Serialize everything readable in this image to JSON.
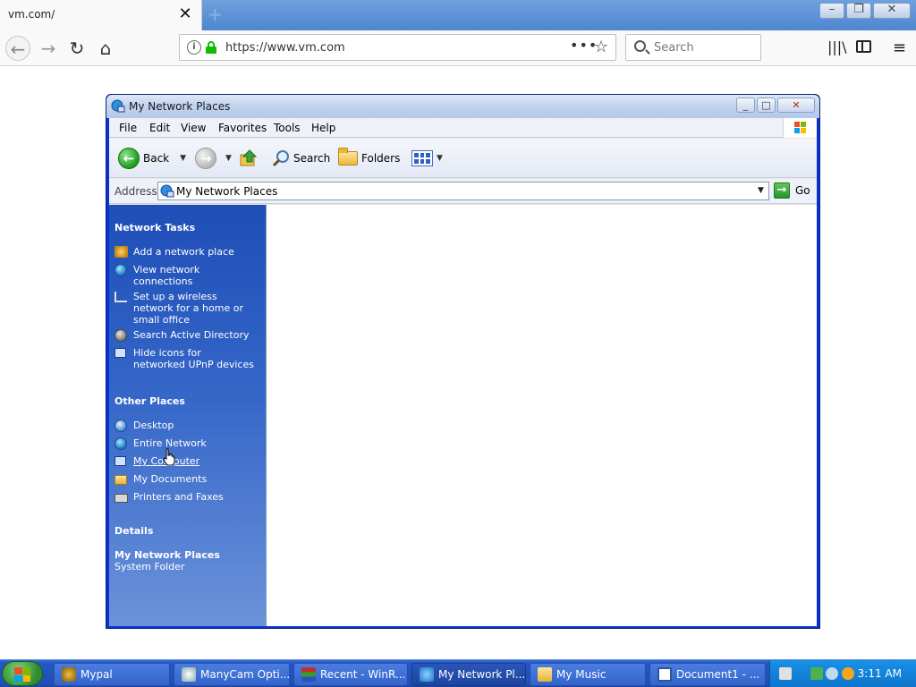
{
  "browser": {
    "tab_title": "vm.com/",
    "tab_close": "✕",
    "new_tab": "+",
    "url": "https://www.vm.com",
    "search_placeholder": "Search",
    "url_menu": "•••",
    "bookmark_star": "☆",
    "library": "|||\\",
    "menu": "≡"
  },
  "window": {
    "title": "My Network Places",
    "menus": [
      "File",
      "Edit",
      "View",
      "Favorites",
      "Tools",
      "Help"
    ],
    "toolbar": {
      "back": "Back",
      "search": "Search",
      "folders": "Folders"
    },
    "address_label": "Address",
    "address_value": "My Network Places",
    "go_label": "Go"
  },
  "sidebar": {
    "network_tasks_title": "Network Tasks",
    "network_tasks": [
      {
        "label": "Add a network place",
        "icon": "add-network-place-icon"
      },
      {
        "label": "View network\nconnections",
        "icon": "network-connections-icon"
      },
      {
        "label": "Set up a wireless\nnetwork for a home or\nsmall office",
        "icon": "wireless-icon"
      },
      {
        "label": "Search Active Directory",
        "icon": "active-directory-icon"
      },
      {
        "label": "Hide icons for\nnetworked UPnP devices",
        "icon": "upnp-icon"
      }
    ],
    "other_places_title": "Other Places",
    "other_places": [
      {
        "label": "Desktop",
        "icon": "desktop-icon"
      },
      {
        "label": "Entire Network",
        "icon": "entire-network-icon"
      },
      {
        "label": "My Computer",
        "icon": "my-computer-icon"
      },
      {
        "label": "My Documents",
        "icon": "my-documents-icon"
      },
      {
        "label": "Printers and Faxes",
        "icon": "printers-icon"
      }
    ],
    "details_title": "Details",
    "details_name": "My Network Places",
    "details_type": "System Folder"
  },
  "taskbar": {
    "tasks": [
      "Mypal",
      "ManyCam Opti...",
      "Recent - WinR...",
      "My Network Pl...",
      "My Music",
      "Document1 - ..."
    ],
    "active_task": "My Network Pl...",
    "clock": "3:11 AM"
  },
  "colors": {
    "xp_blue": "#0831d9",
    "sidebar_top": "#1e4eb7",
    "taskbar": "#2457c4",
    "tray": "#1790e6"
  }
}
